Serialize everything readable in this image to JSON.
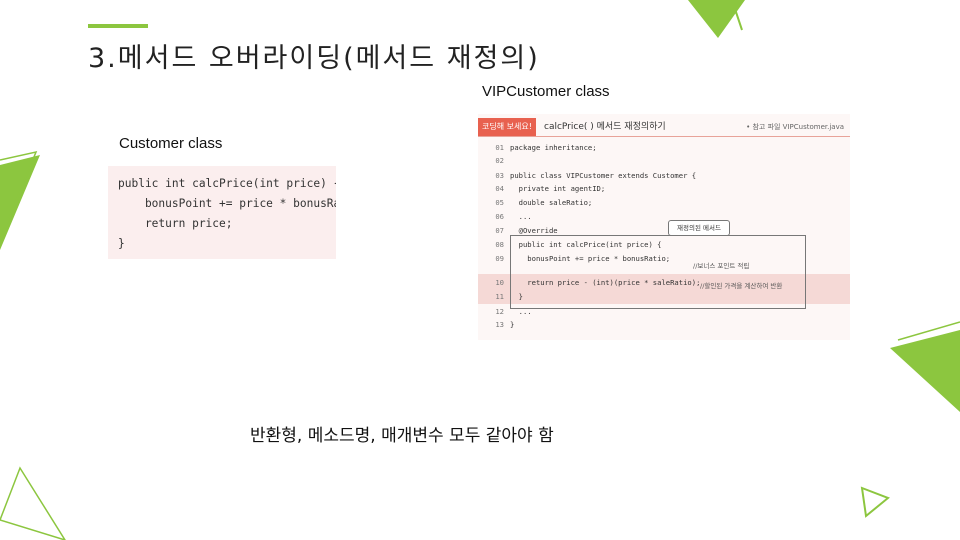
{
  "slide": {
    "title": "3.메서드  오버라이딩(메서드  재정의)",
    "accent_color": "#8cc63f",
    "left_label": "Customer class",
    "right_label": "VIPCustomer class",
    "left_code": "public int calcPrice(int price) {\n    bonusPoint += price * bonusRatio;\n    return price;\n}",
    "book": {
      "tag": "코딩해 보세요!",
      "header": "calcPrice( ) 메서드 재정의하기",
      "ref_file": "• 참고 파일 VIPCustomer.java",
      "lines": [
        {
          "n": "01",
          "code": "package inheritance;"
        },
        {
          "n": "02",
          "code": ""
        },
        {
          "n": "03",
          "code": "public class VIPCustomer extends Customer {"
        },
        {
          "n": "04",
          "code": "  private int agentID;"
        },
        {
          "n": "05",
          "code": "  double saleRatio;"
        },
        {
          "n": "06",
          "code": "  ..."
        },
        {
          "n": "07",
          "code": "  @Override"
        },
        {
          "n": "08",
          "code": "  public int calcPrice(int price) {"
        },
        {
          "n": "09",
          "code": "    bonusPoint += price * bonusRatio;"
        },
        {
          "n": "10",
          "code": "    return price - (int)(price * saleRatio);"
        },
        {
          "n": "11",
          "code": "  }"
        },
        {
          "n": "12",
          "code": "  ..."
        },
        {
          "n": "13",
          "code": "}"
        }
      ],
      "callout": "재정의된 메서드",
      "comment_bonus": "//보너스 포인트 적립",
      "comment_discount": "//할인된 가격을 계산하여 반환"
    },
    "bottom_text": "반환형, 메소드명, 매개변수 모두 같아야 함"
  }
}
